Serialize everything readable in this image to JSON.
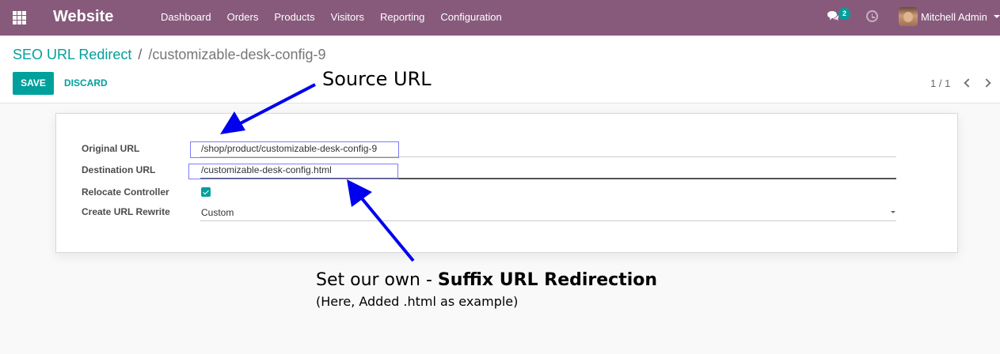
{
  "navbar": {
    "app_title": "Website",
    "menu": [
      "Dashboard",
      "Orders",
      "Products",
      "Visitors",
      "Reporting",
      "Configuration"
    ],
    "chat_count": "2",
    "user_name": "Mitchell Admin",
    "color": "#875a7b"
  },
  "control_panel": {
    "breadcrumb_parent": "SEO URL Redirect",
    "breadcrumb_separator": "/",
    "breadcrumb_current": "/customizable-desk-config-9",
    "save_label": "SAVE",
    "discard_label": "DISCARD",
    "pager": "1 / 1"
  },
  "form": {
    "original_url_label": "Original URL",
    "original_url_value": "/shop/product/customizable-desk-config-9",
    "destination_url_label": "Destination URL",
    "destination_url_value": "/customizable-desk-config.html",
    "relocate_label": "Relocate Controller",
    "relocate_checked": true,
    "rewrite_label": "Create URL Rewrite",
    "rewrite_value": "Custom"
  },
  "annotations": {
    "source": "Source URL",
    "suffix_prefix": "Set our own - ",
    "suffix_bold": "Suffix URL Redirection",
    "note": "(Here, Added .html as example)",
    "arrow_color": "#0000ee"
  },
  "colors": {
    "accent": "#00a09d"
  }
}
